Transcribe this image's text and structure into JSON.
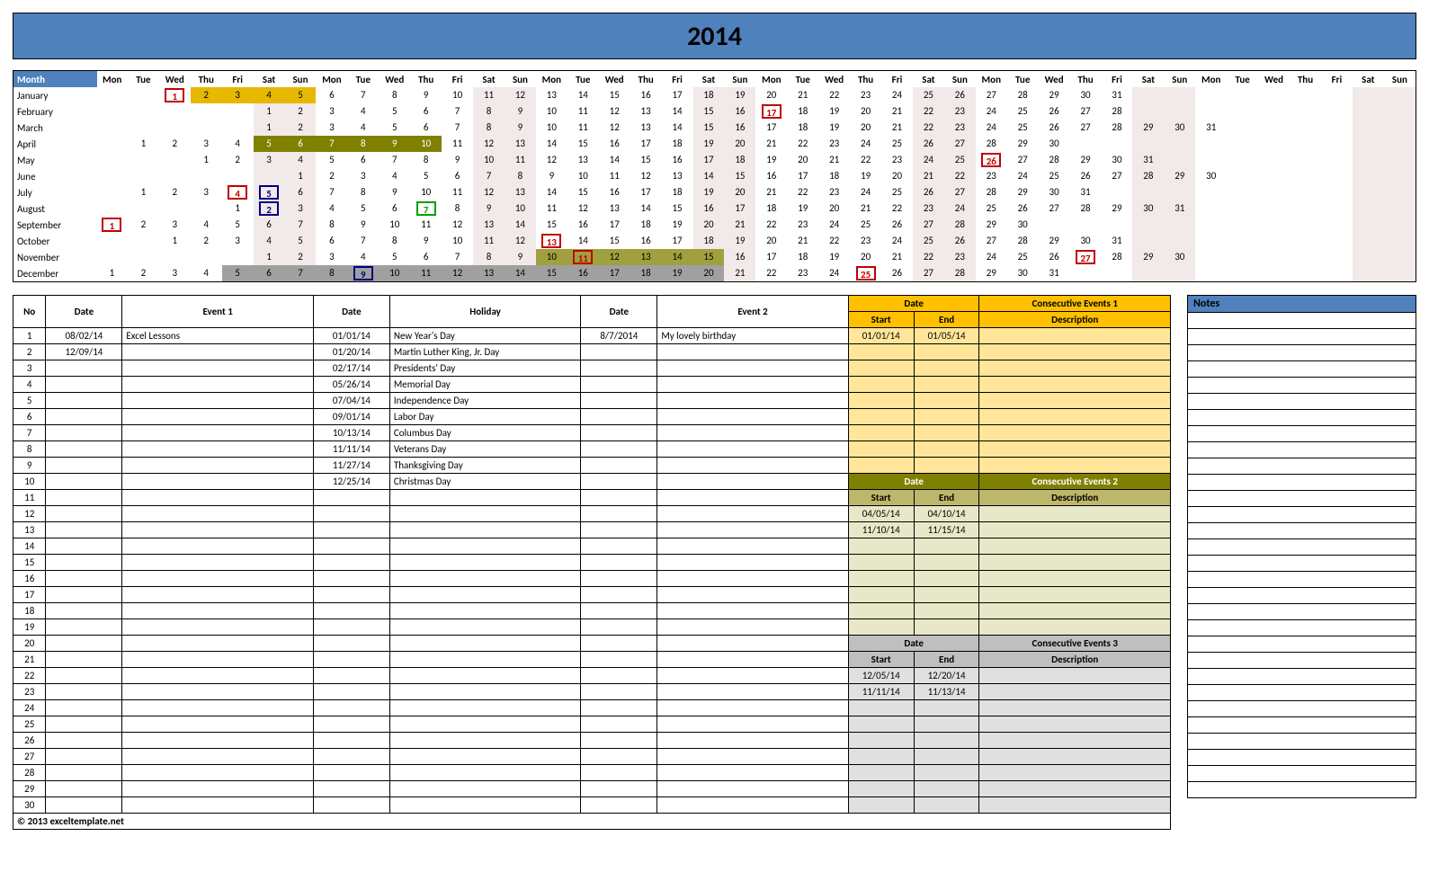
{
  "year": "2014",
  "copyright": "© 2013 exceltemplate.net",
  "monthHeader": "Month",
  "dow": [
    "Mon",
    "Tue",
    "Wed",
    "Thu",
    "Fri",
    "Sat",
    "Sun"
  ],
  "months": [
    {
      "name": "January",
      "startCol": 2,
      "days": 31,
      "special": {
        "1": "rbox"
      },
      "strip": {
        "from": 2,
        "to": 5,
        "cls": "shade-gold"
      }
    },
    {
      "name": "February",
      "startCol": 5,
      "days": 28,
      "special": {
        "17": "rbox"
      }
    },
    {
      "name": "March",
      "startCol": 5,
      "days": 31
    },
    {
      "name": "April",
      "startCol": 1,
      "days": 30,
      "strip": {
        "from": 5,
        "to": 10,
        "cls": "shade-olive"
      }
    },
    {
      "name": "May",
      "startCol": 3,
      "days": 31,
      "special": {
        "26": "rbox"
      }
    },
    {
      "name": "June",
      "startCol": 6,
      "days": 30
    },
    {
      "name": "July",
      "startCol": 1,
      "days": 31,
      "special": {
        "4": "rbox",
        "5": "bbox"
      }
    },
    {
      "name": "August",
      "startCol": 4,
      "days": 31,
      "special": {
        "2": "bbox",
        "7": "gbox"
      }
    },
    {
      "name": "September",
      "startCol": 0,
      "days": 30,
      "special": {
        "1": "rbox"
      }
    },
    {
      "name": "October",
      "startCol": 2,
      "days": 31,
      "special": {
        "13": "rbox"
      }
    },
    {
      "name": "November",
      "startCol": 5,
      "days": 30,
      "special": {
        "11": "rbox",
        "27": "rbox"
      },
      "strip": {
        "from": 10,
        "to": 15,
        "cls": "shade-olive2"
      }
    },
    {
      "name": "December",
      "startCol": 0,
      "days": 31,
      "special": {
        "9": "bbox",
        "25": "rbox"
      },
      "strip": {
        "from": 5,
        "to": 20,
        "cls": "shade-gray"
      }
    }
  ],
  "headers": {
    "no": "No",
    "date": "Date",
    "event1": "Event 1",
    "holiday": "Holiday",
    "event2": "Event 2",
    "start": "Start",
    "end": "End",
    "desc": "Description",
    "ce1": "Consecutive Events 1",
    "ce2": "Consecutive Events 2",
    "ce3": "Consecutive Events 3",
    "notes": "Notes"
  },
  "event1": [
    {
      "date": "08/02/14",
      "name": "Excel Lessons"
    },
    {
      "date": "12/09/14",
      "name": ""
    }
  ],
  "holidays": [
    {
      "date": "01/01/14",
      "name": "New Year's Day"
    },
    {
      "date": "01/20/14",
      "name": "Martin Luther King, Jr. Day"
    },
    {
      "date": "02/17/14",
      "name": "Presidents' Day"
    },
    {
      "date": "05/26/14",
      "name": "Memorial Day"
    },
    {
      "date": "07/04/14",
      "name": "Independence Day"
    },
    {
      "date": "09/01/14",
      "name": "Labor Day"
    },
    {
      "date": "10/13/14",
      "name": "Columbus Day"
    },
    {
      "date": "11/11/14",
      "name": "Veterans Day"
    },
    {
      "date": "11/27/14",
      "name": "Thanksgiving Day"
    },
    {
      "date": "12/25/14",
      "name": "Christmas Day"
    }
  ],
  "event2": [
    {
      "date": "8/7/2014",
      "name": "My lovely birthday"
    }
  ],
  "ce1": [
    {
      "start": "01/01/14",
      "end": "01/05/14",
      "desc": ""
    }
  ],
  "ce2": [
    {
      "start": "04/05/14",
      "end": "04/10/14",
      "desc": ""
    },
    {
      "start": "11/10/14",
      "end": "11/15/14",
      "desc": ""
    }
  ],
  "ce3": [
    {
      "start": "12/05/14",
      "end": "12/20/14",
      "desc": ""
    },
    {
      "start": "11/11/14",
      "end": "11/13/14",
      "desc": ""
    }
  ],
  "rows": 30,
  "notesRows": 30
}
